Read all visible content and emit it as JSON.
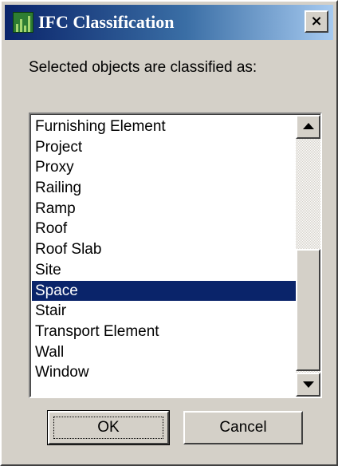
{
  "window": {
    "title": "IFC Classification",
    "close_glyph": "×",
    "icon": "ifc-app-icon"
  },
  "prompt": "Selected objects are classified as:",
  "list": {
    "items": [
      "Furnishing Element",
      "Project",
      "Proxy",
      "Railing",
      "Ramp",
      "Roof",
      "Roof Slab",
      "Site",
      "Space",
      "Stair",
      "Transport Element",
      "Wall",
      "Window"
    ],
    "selected": "Space"
  },
  "buttons": {
    "ok": "OK",
    "cancel": "Cancel"
  },
  "colors": {
    "selection": "#0a246a",
    "dialog_face": "#d4d0c8"
  }
}
